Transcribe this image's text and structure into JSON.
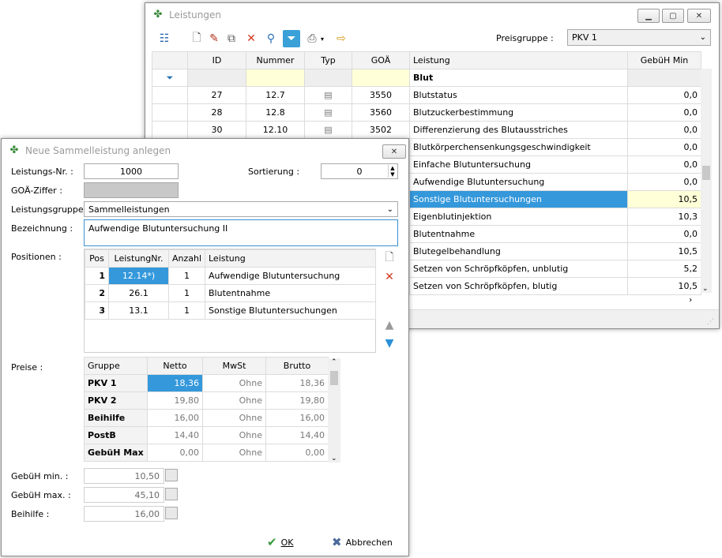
{
  "main_window": {
    "title": "Leistungen",
    "preisgruppe_label": "Preisgruppe :",
    "preisgruppe_value": "PKV 1",
    "columns": [
      "ID",
      "Nummer",
      "Typ",
      "GOÄ",
      "Leistung",
      "GebüH Min"
    ],
    "group_header": "Blut",
    "rows": [
      {
        "id": "27",
        "nummer": "12.7",
        "goa": "3550",
        "leistung": "Blutstatus",
        "min": "0,0"
      },
      {
        "id": "28",
        "nummer": "12.8",
        "goa": "3560",
        "leistung": "Blutzuckerbestimmung",
        "min": "0,0"
      },
      {
        "id": "30",
        "nummer": "12.10",
        "goa": "3502",
        "leistung": "Differenzierung des Blutausstriches",
        "min": "0,0"
      },
      {
        "leistung": "Blutkörperchensenkungsgeschwindigkeit",
        "min": "0,0"
      },
      {
        "leistung": "Einfache Blutuntersuchung",
        "min": "0,0"
      },
      {
        "leistung": "Aufwendige Blutuntersuchung",
        "min": "0,0"
      },
      {
        "leistung": "Sonstige Blutuntersuchungen",
        "min": "10,5"
      },
      {
        "leistung": "Eigenblutinjektion",
        "min": "10,3"
      },
      {
        "leistung": "Blutentnahme",
        "min": "0,0"
      },
      {
        "leistung": "Blutegelbehandlung",
        "min": "10,5"
      },
      {
        "leistung": "Setzen von Schröpfköpfen, unblutig",
        "min": "5,2"
      },
      {
        "leistung": "Setzen von Schröpfköpfen, blutig",
        "min": "10,5"
      }
    ]
  },
  "dialog": {
    "title": "Neue Sammelleistung anlegen",
    "labels": {
      "leistungs_nr": "Leistungs-Nr. :",
      "sortierung": "Sortierung :",
      "goa_ziffer": "GOÄ-Ziffer :",
      "leistungsgruppe": "Leistungsgruppe :",
      "bezeichnung": "Bezeichnung :",
      "positionen": "Positionen :",
      "preise": "Preise :",
      "gebuh_min": "GebüH min. :",
      "gebuh_max": "GebüH max. :",
      "beihilfe": "Beihilfe :"
    },
    "leistungs_nr": "1000",
    "sortierung": "0",
    "leistungsgruppe": "Sammelleistungen",
    "bezeichnung": "Aufwendige Blutuntersuchung II",
    "positions_columns": [
      "Pos",
      "LeistungNr.",
      "Anzahl",
      "Leistung"
    ],
    "positions": [
      {
        "pos": "1",
        "nr": "12.14*)",
        "anzahl": "1",
        "leistung": "Aufwendige Blutuntersuchung"
      },
      {
        "pos": "2",
        "nr": "26.1",
        "anzahl": "1",
        "leistung": "Blutentnahme"
      },
      {
        "pos": "3",
        "nr": "13.1",
        "anzahl": "1",
        "leistung": "Sonstige Blutuntersuchungen"
      }
    ],
    "prices_columns": [
      "Gruppe",
      "Netto",
      "MwSt",
      "Brutto"
    ],
    "prices": [
      {
        "gruppe": "PKV 1",
        "netto": "18,36",
        "mwst": "Ohne",
        "brutto": "18,36"
      },
      {
        "gruppe": "PKV 2",
        "netto": "19,80",
        "mwst": "Ohne",
        "brutto": "19,80"
      },
      {
        "gruppe": "Beihilfe",
        "netto": "16,00",
        "mwst": "Ohne",
        "brutto": "16,00"
      },
      {
        "gruppe": "PostB",
        "netto": "14,40",
        "mwst": "Ohne",
        "brutto": "14,40"
      },
      {
        "gruppe": "GebüH Max",
        "netto": "0,00",
        "mwst": "Ohne",
        "brutto": "0,00"
      }
    ],
    "gebuh_min": "10,50",
    "gebuh_max": "45,10",
    "beihilfe": "16,00",
    "ok_label": "OK",
    "cancel_label": "Abbrechen"
  },
  "colors": {
    "selection": "#3498db",
    "filter_row": "#ffffd8"
  }
}
